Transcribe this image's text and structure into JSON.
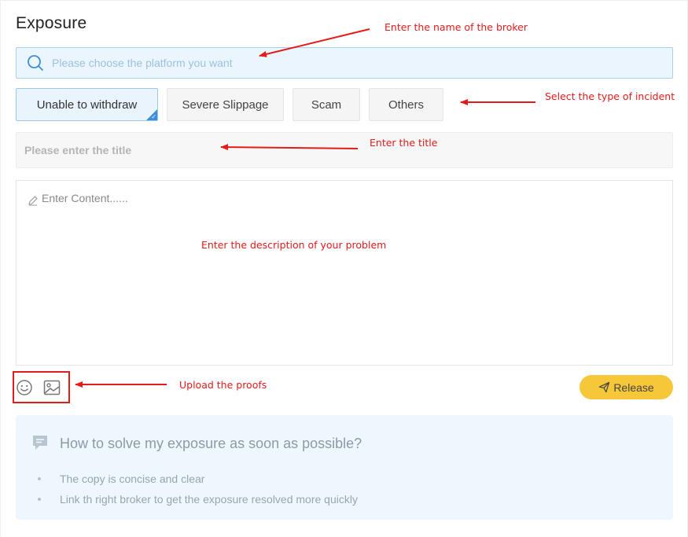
{
  "page": {
    "title": "Exposure"
  },
  "search": {
    "placeholder": "Please choose the platform you want",
    "value": ""
  },
  "incident_types": [
    {
      "label": "Unable to withdraw",
      "selected": true
    },
    {
      "label": "Severe Slippage",
      "selected": false
    },
    {
      "label": "Scam",
      "selected": false
    },
    {
      "label": "Others",
      "selected": false
    }
  ],
  "title_field": {
    "placeholder": "Please enter the title",
    "value": ""
  },
  "content_field": {
    "placeholder": "Enter Content......",
    "value": ""
  },
  "toolbar": {
    "emoji_icon": "smiley-icon",
    "image_icon": "image-upload-icon",
    "release_label": "Release"
  },
  "tips": {
    "title": "How to solve my exposure as soon as possible?",
    "items": [
      "The copy is concise and clear",
      "Link th right broker to get the exposure resolved more quickly"
    ]
  },
  "annotations": {
    "broker": "Enter the name of the broker",
    "incident": "Select the type of incident",
    "title": "Enter the title",
    "description": "Enter the description of your problem",
    "proofs": "Upload the proofs"
  },
  "colors": {
    "accent_blue": "#3d8fdc",
    "search_bg": "#eaf5fd",
    "release_yellow": "#f5c739",
    "annotation_red": "#e31b1b",
    "tips_bg": "#eef7fd"
  }
}
